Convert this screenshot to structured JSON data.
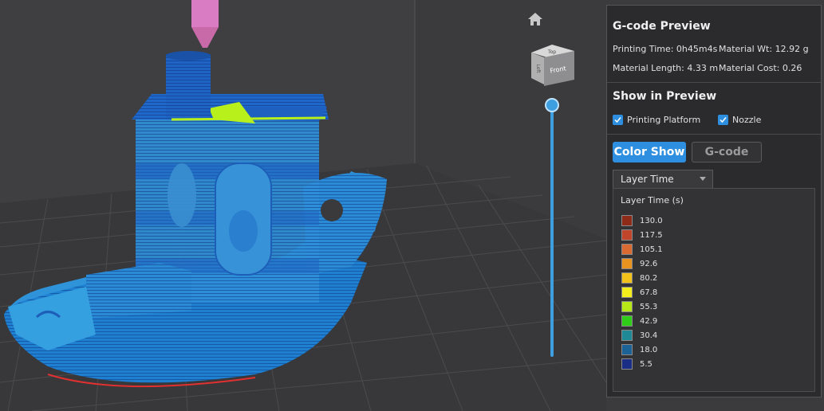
{
  "preview_panel": {
    "title": "G-code Preview",
    "printing_time_label": "Printing Time: 0h45m4s",
    "material_weight_label": "Material Wt: 12.92 g",
    "material_length_label": "Material Length: 4.33 m",
    "material_cost_label": "Material Cost: 0.26"
  },
  "show_in_preview": {
    "title": "Show in Preview",
    "printing_platform": {
      "label": "Printing Platform",
      "checked": true
    },
    "nozzle": {
      "label": "Nozzle",
      "checked": true
    }
  },
  "mode_buttons": {
    "color_show": "Color Show",
    "gcode": "G-code"
  },
  "color_mode_dropdown": {
    "selected": "Layer Time"
  },
  "legend": {
    "title": "Layer Time (s)",
    "items": [
      {
        "value": "130.0",
        "color": "#8e2a18"
      },
      {
        "value": "117.5",
        "color": "#c0452a"
      },
      {
        "value": "105.1",
        "color": "#d96a32"
      },
      {
        "value": "92.6",
        "color": "#e8921f"
      },
      {
        "value": "80.2",
        "color": "#f2c21a"
      },
      {
        "value": "67.8",
        "color": "#f4ee1c"
      },
      {
        "value": "55.3",
        "color": "#b6e818"
      },
      {
        "value": "42.9",
        "color": "#2fcc18"
      },
      {
        "value": "30.4",
        "color": "#1f8a96"
      },
      {
        "value": "18.0",
        "color": "#1d6296"
      },
      {
        "value": "5.5",
        "color": "#1a2e86"
      }
    ]
  },
  "nav_cube": {
    "top_face": "Top",
    "front_face": "Front",
    "left_face": "Left"
  },
  "icons": {
    "home": "home-icon",
    "check": "checkmark-icon"
  },
  "layer_slider": {
    "position": 1.0
  }
}
